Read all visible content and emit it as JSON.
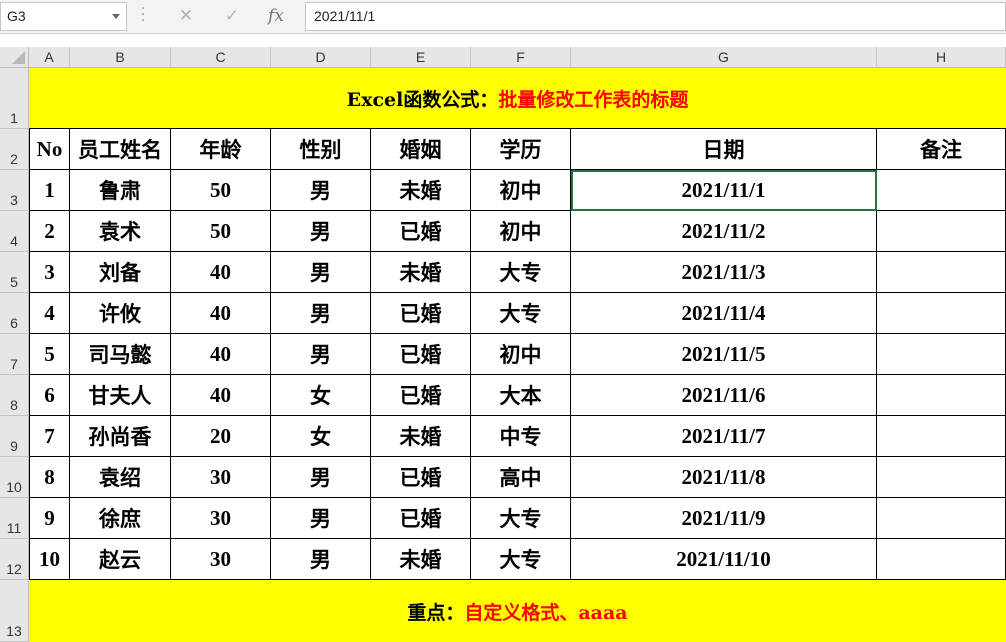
{
  "formula_bar": {
    "name_box": "G3",
    "cancel_icon": "✕",
    "enter_icon": "✓",
    "fx_label": "fx",
    "formula_value": "2021/11/1"
  },
  "columns": [
    "A",
    "B",
    "C",
    "D",
    "E",
    "F",
    "G",
    "H"
  ],
  "rows": [
    "1",
    "2",
    "3",
    "4",
    "5",
    "6",
    "7",
    "8",
    "9",
    "10",
    "11",
    "12",
    "13"
  ],
  "title_banner": {
    "black_part": "Excel函数公式：",
    "red_part": "批量修改工作表的标题"
  },
  "table": {
    "headers": [
      "No",
      "员工姓名",
      "年龄",
      "性别",
      "婚姻",
      "学历",
      "日期",
      "备注"
    ],
    "records": [
      [
        "1",
        "鲁肃",
        "50",
        "男",
        "未婚",
        "初中",
        "2021/11/1",
        ""
      ],
      [
        "2",
        "袁术",
        "50",
        "男",
        "已婚",
        "初中",
        "2021/11/2",
        ""
      ],
      [
        "3",
        "刘备",
        "40",
        "男",
        "未婚",
        "大专",
        "2021/11/3",
        ""
      ],
      [
        "4",
        "许攸",
        "40",
        "男",
        "已婚",
        "大专",
        "2021/11/4",
        ""
      ],
      [
        "5",
        "司马懿",
        "40",
        "男",
        "已婚",
        "初中",
        "2021/11/5",
        ""
      ],
      [
        "6",
        "甘夫人",
        "40",
        "女",
        "已婚",
        "大本",
        "2021/11/6",
        ""
      ],
      [
        "7",
        "孙尚香",
        "20",
        "女",
        "未婚",
        "中专",
        "2021/11/7",
        ""
      ],
      [
        "8",
        "袁绍",
        "30",
        "男",
        "已婚",
        "高中",
        "2021/11/8",
        ""
      ],
      [
        "9",
        "徐庶",
        "30",
        "男",
        "已婚",
        "大专",
        "2021/11/9",
        ""
      ],
      [
        "10",
        "赵云",
        "30",
        "男",
        "未婚",
        "大专",
        "2021/11/10",
        ""
      ]
    ]
  },
  "footer_banner": {
    "black_part": "重点：",
    "red_part": "自定义格式、aaaa"
  },
  "colors": {
    "banner_fill": "#ffff00",
    "accent_red": "#ff0000",
    "selection_green": "#217346"
  }
}
